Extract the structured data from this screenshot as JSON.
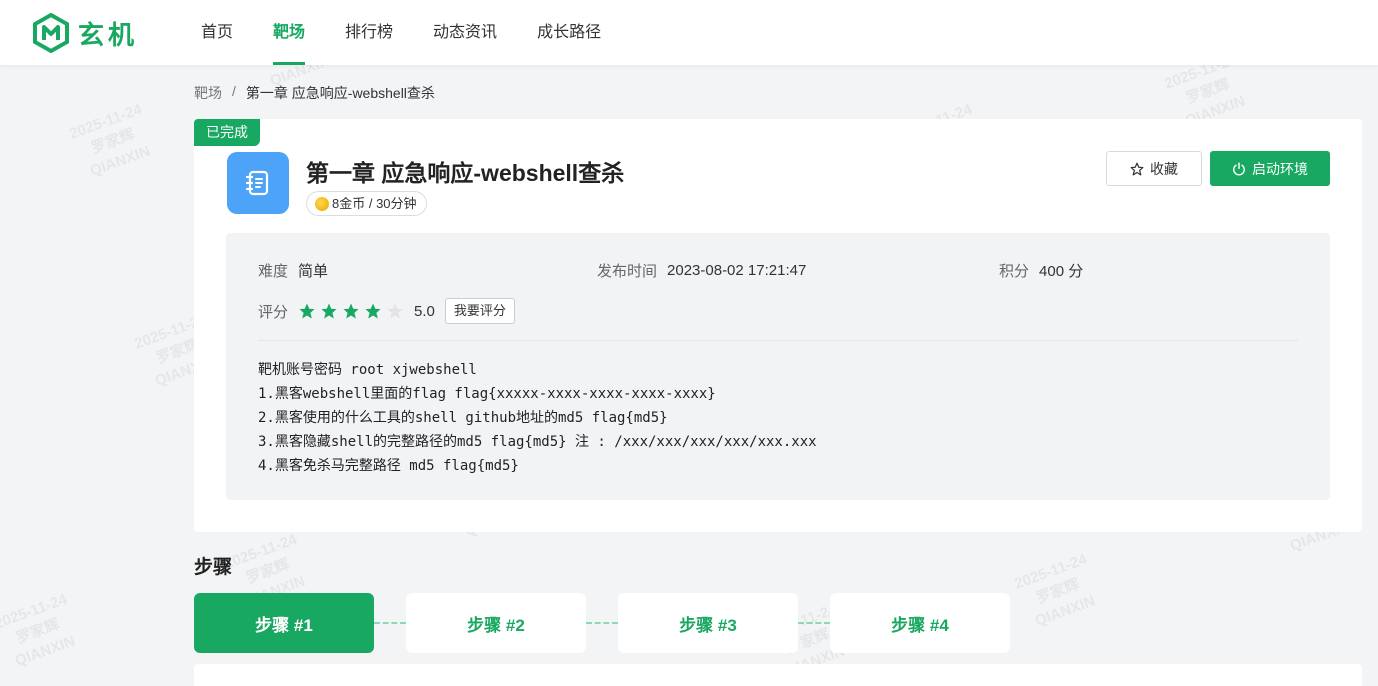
{
  "brand": {
    "name": "玄机",
    "color": "#19a862"
  },
  "nav": {
    "items": [
      {
        "label": "首页",
        "active": false
      },
      {
        "label": "靶场",
        "active": true
      },
      {
        "label": "排行榜",
        "active": false
      },
      {
        "label": "动态资讯",
        "active": false
      },
      {
        "label": "成长路径",
        "active": false
      }
    ]
  },
  "breadcrumb": {
    "root": "靶场",
    "separator": "/",
    "current": "第一章 应急响应-webshell查杀"
  },
  "challenge": {
    "status_tag": "已完成",
    "title": "第一章 应急响应-webshell查杀",
    "reward": "8金币 / 30分钟",
    "icon": "notebook-icon",
    "favorite_label": "收藏",
    "start_label": "启动环境",
    "difficulty_label": "难度",
    "difficulty_value": "简单",
    "publish_label": "发布时间",
    "publish_value": "2023-08-02 17:21:47",
    "score_label": "积分",
    "score_value": "400 分",
    "rating_label": "评分",
    "rating_stars": 4,
    "rating_max": 5,
    "rating_value": "5.0",
    "rate_button": "我要评分",
    "description": [
      "靶机账号密码 root xjwebshell",
      "1.黑客webshell里面的flag flag{xxxxx-xxxx-xxxx-xxxx-xxxx}",
      "2.黑客使用的什么工具的shell github地址的md5 flag{md5}",
      "3.黑客隐藏shell的完整路径的md5 flag{md5} 注 : /xxx/xxx/xxx/xxx/xxx.xxx",
      "4.黑客免杀马完整路径 md5 flag{md5}"
    ]
  },
  "steps": {
    "title": "步骤",
    "items": [
      {
        "label": "步骤 #1",
        "active": true
      },
      {
        "label": "步骤 #2",
        "active": false
      },
      {
        "label": "步骤 #3",
        "active": false
      },
      {
        "label": "步骤 #4",
        "active": false
      }
    ]
  },
  "watermark": {
    "date": "2025-11-24",
    "name": "罗家辉",
    "org": "QIANXIN"
  }
}
